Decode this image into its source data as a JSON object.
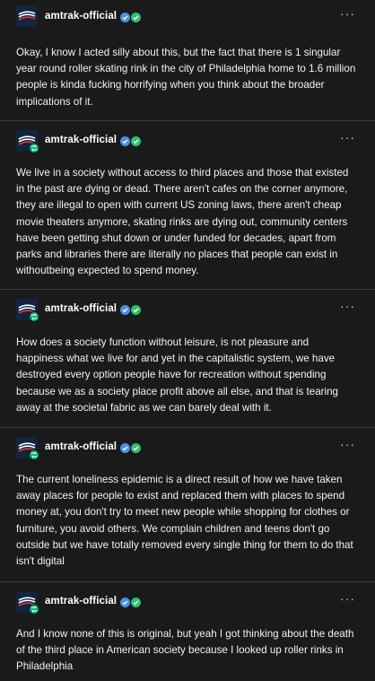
{
  "posts": [
    {
      "username": "amtrak-official",
      "more": "···",
      "reblog": false,
      "text": "Okay, I know I acted silly about this, but the fact that there is 1 singular year round roller skating rink in the city of Philadelphia home to 1.6 million people is kinda fucking horrifying when you think about the broader implications of it."
    },
    {
      "username": "amtrak-official",
      "more": "···",
      "reblog": true,
      "text": "We live in a society without access to third places and those that existed in the past are dying or dead. There aren't cafes on the corner anymore, they are illegal to open with current US zoning laws,  there aren't cheap movie theaters anymore, skating rinks are dying out, community centers have been getting shut down or under funded for decades, apart from parks and libraries there are literally no places that people can exist in withoutbeing expected to spend money."
    },
    {
      "username": "amtrak-official",
      "more": "···",
      "reblog": true,
      "text": "How does a society function without leisure, is not pleasure and happiness what we live for and yet in the capitalistic system, we have destroyed every option people have for recreation without spending because we as a society place profit above all else, and that is tearing away at the societal fabric as we can barely deal with it."
    },
    {
      "username": "amtrak-official",
      "more": "···",
      "reblog": true,
      "text": "The current loneliness epidemic is a direct result of how we have taken away places for people to exist and replaced them with places to spend money at, you don't try to meet new people while shopping for clothes or furniture, you avoid others. We complain children and teens don't go outside but we have totally removed every single thing for them to do that isn't digital"
    },
    {
      "username": "amtrak-official",
      "more": "···",
      "reblog": true,
      "text": "And I know none of this is original, but yeah I got thinking about the death of the third place in American society because I looked up roller rinks in Philadelphia"
    }
  ],
  "colors": {
    "background": "#1a1a1a",
    "divider": "#3a3a3a",
    "verified_blue": "#4a8fe6",
    "verified_green": "#2fc26b",
    "reblog_green": "#00b46b",
    "avatar_navy": "#13243f"
  },
  "icons": {
    "avatar": "amtrak-logo-icon",
    "reblog": "reblog-icon",
    "verified": "verified-check-icon",
    "more": "more-options-icon"
  }
}
